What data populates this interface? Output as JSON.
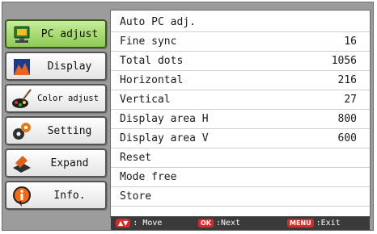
{
  "sidebar": {
    "items": [
      {
        "label": "PC adjust",
        "icon": "pc-adjust-icon",
        "active": true
      },
      {
        "label": "Display",
        "icon": "display-icon",
        "active": false
      },
      {
        "label": "Color adjust",
        "icon": "color-adjust-icon",
        "active": false
      },
      {
        "label": "Setting",
        "icon": "setting-icon",
        "active": false
      },
      {
        "label": "Expand",
        "icon": "expand-icon",
        "active": false
      },
      {
        "label": "Info.",
        "icon": "info-icon",
        "active": false
      }
    ]
  },
  "menu": {
    "rows": [
      {
        "label": "Auto PC adj.",
        "value": ""
      },
      {
        "label": "Fine sync",
        "value": "16"
      },
      {
        "label": "Total dots",
        "value": "1056"
      },
      {
        "label": "Horizontal",
        "value": "216"
      },
      {
        "label": "Vertical",
        "value": "27"
      },
      {
        "label": "Display area H",
        "value": "800"
      },
      {
        "label": "Display area V",
        "value": "600"
      },
      {
        "label": "Reset",
        "value": ""
      },
      {
        "label": "Mode free",
        "value": ""
      },
      {
        "label": "Store",
        "value": ""
      }
    ]
  },
  "footer": {
    "move_key": "▲▼",
    "move_label": ": Move",
    "ok_key": "OK",
    "next_label": ":Next",
    "menu_key": "MENU",
    "exit_label": ":Exit"
  },
  "colors": {
    "frame": "#9b9b9b",
    "active_tab": "#8ecb53",
    "footer_bg": "#3a3a3a",
    "key_red": "#d12d2d"
  }
}
